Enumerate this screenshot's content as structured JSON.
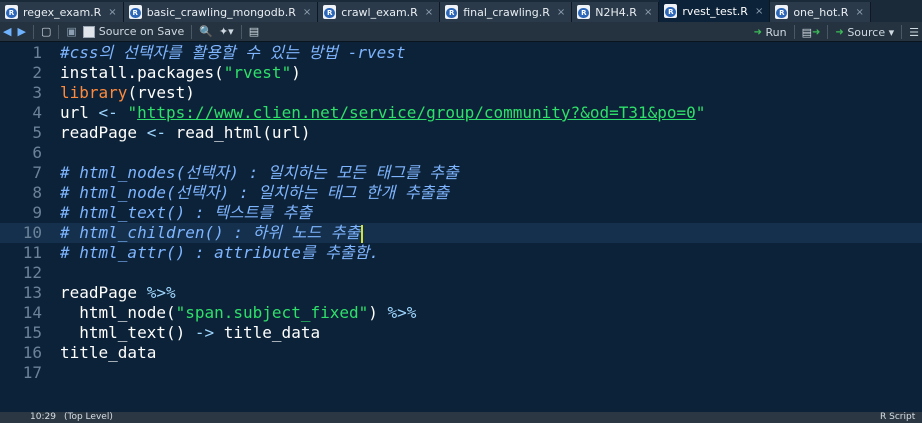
{
  "tabs": [
    {
      "label": "regex_exam.R",
      "active": false
    },
    {
      "label": "basic_crawling_mongodb.R",
      "active": false
    },
    {
      "label": "crawl_exam.R",
      "active": false
    },
    {
      "label": "final_crawling.R",
      "active": false
    },
    {
      "label": "N2H4.R",
      "active": false
    },
    {
      "label": "rvest_test.R",
      "active": true
    },
    {
      "label": "one_hot.R",
      "active": false
    }
  ],
  "toolbar": {
    "source_on_save": "Source on Save",
    "run": "Run",
    "source": "Source"
  },
  "editor": {
    "lines": [
      {
        "n": "1",
        "parts": [
          {
            "t": "#css의 선택자를 활용할 수 있는 방법 -rvest",
            "c": "cm"
          }
        ]
      },
      {
        "n": "2",
        "parts": [
          {
            "t": "install.packages(",
            "c": ""
          },
          {
            "t": "\"rvest\"",
            "c": "str"
          },
          {
            "t": ")",
            "c": ""
          }
        ]
      },
      {
        "n": "3",
        "parts": [
          {
            "t": "library",
            "c": "lib"
          },
          {
            "t": "(rvest)",
            "c": ""
          }
        ]
      },
      {
        "n": "4",
        "parts": [
          {
            "t": "url ",
            "c": ""
          },
          {
            "t": "<-",
            "c": "op"
          },
          {
            "t": " ",
            "c": ""
          },
          {
            "t": "\"",
            "c": "str"
          },
          {
            "t": "https://www.clien.net/service/group/community?&od=T31&po=0",
            "c": "str link"
          },
          {
            "t": "\"",
            "c": "str"
          }
        ]
      },
      {
        "n": "5",
        "parts": [
          {
            "t": "readPage ",
            "c": ""
          },
          {
            "t": "<-",
            "c": "op"
          },
          {
            "t": " read_html(url)",
            "c": ""
          }
        ]
      },
      {
        "n": "6",
        "parts": []
      },
      {
        "n": "7",
        "parts": [
          {
            "t": "# html_nodes(선택자) : 일치하는 모든 태그를 추출",
            "c": "cm"
          }
        ]
      },
      {
        "n": "8",
        "parts": [
          {
            "t": "# html_node(선택자) : 일치하는 태그 한개 추출출",
            "c": "cm"
          }
        ]
      },
      {
        "n": "9",
        "parts": [
          {
            "t": "# html_text() : 텍스트를 추출",
            "c": "cm"
          }
        ]
      },
      {
        "n": "10",
        "parts": [
          {
            "t": "# html_children() : 하위 노드 추출",
            "c": "cm"
          }
        ],
        "cursor": true
      },
      {
        "n": "11",
        "parts": [
          {
            "t": "# html_attr() : attribute를 추출함.",
            "c": "cm"
          }
        ]
      },
      {
        "n": "12",
        "parts": []
      },
      {
        "n": "13",
        "parts": [
          {
            "t": "readPage ",
            "c": ""
          },
          {
            "t": "%>%",
            "c": "op"
          }
        ]
      },
      {
        "n": "14",
        "parts": [
          {
            "t": "  html_node(",
            "c": ""
          },
          {
            "t": "\"span.subject_fixed\"",
            "c": "str"
          },
          {
            "t": ") ",
            "c": ""
          },
          {
            "t": "%>%",
            "c": "op"
          }
        ]
      },
      {
        "n": "15",
        "parts": [
          {
            "t": "  html_text() ",
            "c": ""
          },
          {
            "t": "->",
            "c": "op"
          },
          {
            "t": " title_data",
            "c": ""
          }
        ]
      },
      {
        "n": "16",
        "parts": [
          {
            "t": "title_data",
            "c": ""
          }
        ]
      },
      {
        "n": "17",
        "parts": []
      }
    ]
  },
  "status": {
    "position": "10:29",
    "scope": "(Top Level)",
    "filetype": "R Script"
  }
}
